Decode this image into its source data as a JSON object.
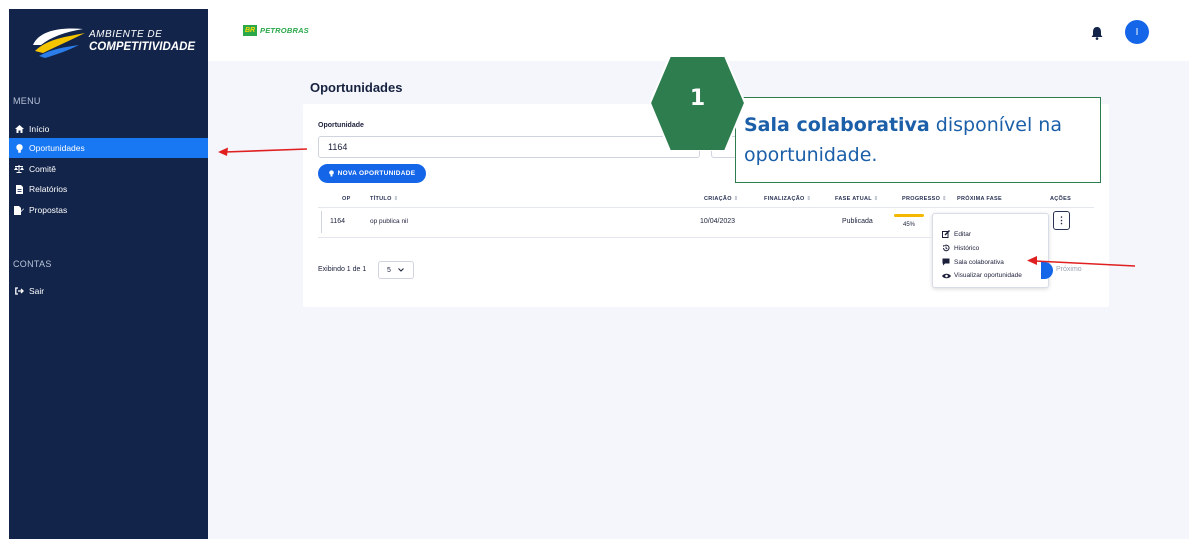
{
  "sidebar": {
    "logo": {
      "line1": "AMBIENTE DE",
      "line2": "COMPETITIVIDADE"
    },
    "menu_heading": "MENU",
    "items": [
      {
        "label": "Início",
        "icon": "home-icon"
      },
      {
        "label": "Oportunidades",
        "icon": "lightbulb-icon",
        "active": true
      },
      {
        "label": "Comitê",
        "icon": "scale-icon"
      },
      {
        "label": "Relatórios",
        "icon": "document-icon"
      },
      {
        "label": "Propostas",
        "icon": "proposal-icon"
      }
    ],
    "accounts_heading": "CONTAS",
    "accounts": [
      {
        "label": "Sair",
        "icon": "logout-icon"
      }
    ]
  },
  "header": {
    "brand_box": "BR",
    "brand_text": "PETROBRAS",
    "avatar_initial": "I"
  },
  "main": {
    "title": "Oportunidades",
    "filter_label": "Oportunidade",
    "filter_value": "1164",
    "new_button": "NOVA OPORTUNIDADE",
    "table": {
      "headers": [
        "OP",
        "TÍTULO",
        "CRIAÇÃO",
        "FINALIZAÇÃO",
        "FASE ATUAL",
        "PROGRESSO",
        "PRÓXIMA FASE",
        "AÇÕES"
      ],
      "rows": [
        {
          "op": "1164",
          "titulo": "op publica nil",
          "criacao": "10/04/2023",
          "finalizacao": "",
          "fase_atual": "Publicada",
          "progresso": "45%",
          "progress_value": 45,
          "proxima_fase": "",
          "acoes": "⋮"
        }
      ]
    },
    "actions_menu": [
      {
        "label": "Editar",
        "icon": "edit-icon"
      },
      {
        "label": "Histórico",
        "icon": "history-icon"
      },
      {
        "label": "Sala colaborativa",
        "icon": "chat-icon"
      },
      {
        "label": "Visualizar oportunidade",
        "icon": "eye-icon"
      }
    ],
    "pagination": {
      "text": "Exibindo 1 de 1",
      "page_size": "5",
      "next": "Próximo"
    }
  },
  "callout": {
    "number": "1",
    "bold": "Sala colaborativa",
    "rest": " disponível na oportunidade."
  },
  "colors": {
    "sidebar_bg": "#12244a",
    "accent": "#1565e8",
    "callout_green": "#2e7d4f",
    "arrow_red": "#e02020",
    "progress": "#f5b800"
  }
}
